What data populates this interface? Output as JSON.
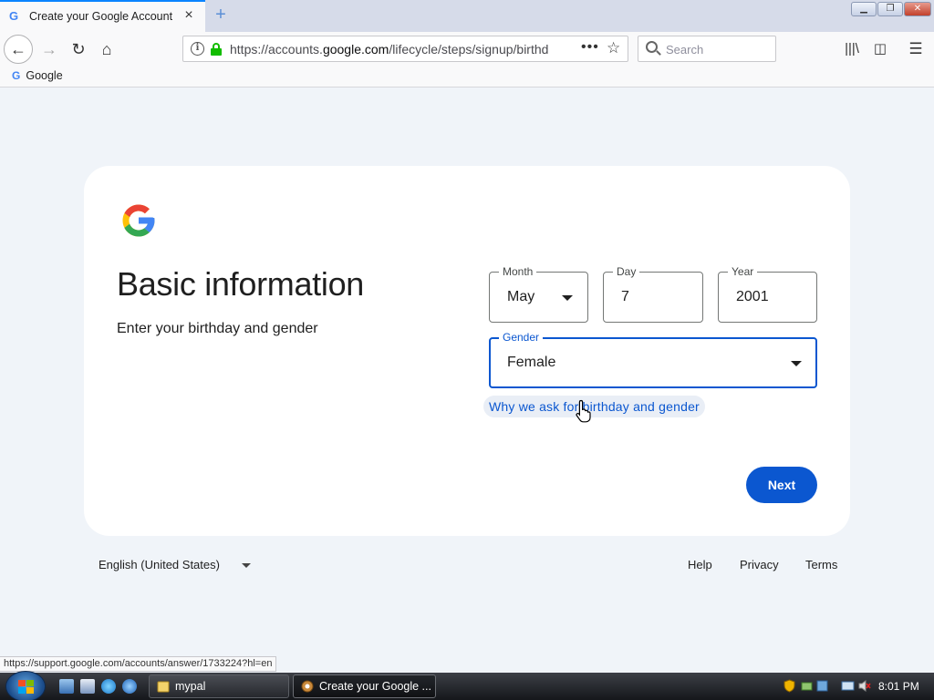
{
  "browser": {
    "tab_title": "Create your Google Account",
    "url_prefix": "https://accounts.",
    "url_host": "google.com",
    "url_path": "/lifecycle/steps/signup/birthd",
    "search_placeholder": "Search",
    "bookmark_label": "Google",
    "status_url": "https://support.google.com/accounts/answer/1733224?hl=en"
  },
  "page": {
    "heading": "Basic information",
    "subheading": "Enter your birthday and gender",
    "month": {
      "label": "Month",
      "value": "May"
    },
    "day": {
      "label": "Day",
      "value": "7"
    },
    "year": {
      "label": "Year",
      "value": "2001"
    },
    "gender": {
      "label": "Gender",
      "value": "Female"
    },
    "why_link": "Why we ask for birthday and gender",
    "next_button": "Next"
  },
  "footer": {
    "language": "English (United States)",
    "help": "Help",
    "privacy": "Privacy",
    "terms": "Terms"
  },
  "taskbar": {
    "task1_label": "mypal",
    "task2_label": "Create your Google ...",
    "clock": "8:01 PM"
  },
  "colors": {
    "accent_blue": "#0b57d0",
    "page_background": "#f0f4f9",
    "secure_lock_green": "#12bc00"
  }
}
